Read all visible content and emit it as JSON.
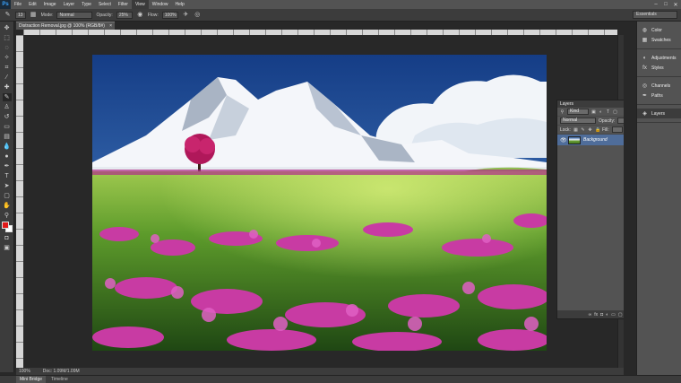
{
  "app": {
    "logo": "Ps",
    "menus": [
      "File",
      "Edit",
      "Image",
      "Layer",
      "Type",
      "Select",
      "Filter",
      "View",
      "Window",
      "Help"
    ],
    "active_menu": "View",
    "window_controls": [
      "–",
      "□",
      "✕"
    ]
  },
  "options_bar": {
    "mode_label": "Mode:",
    "mode_value": "Normal",
    "opacity_label": "Opacity:",
    "opacity_value": "25%",
    "flow_label": "Flow:",
    "flow_value": "100%",
    "brush_size": "13",
    "workspace": "Essentials"
  },
  "document": {
    "tab_title": "Distraction Removal.jpg @ 100% (RGB/8#)",
    "close": "×",
    "zoom": "100%",
    "doc_info": "Doc: 1.09M/1.09M"
  },
  "bottom_tabs": [
    "Mini Bridge",
    "Timeline"
  ],
  "layers_panel": {
    "title": "Layers",
    "filter_value": "Kind",
    "blend_mode": "Normal",
    "opacity_label": "Opacity:",
    "lock_label": "Lock:",
    "fill_label": "Fill:",
    "layer_name": "Background"
  },
  "dock": {
    "groups": [
      [
        "Color",
        "Swatches"
      ],
      [
        "Adjustments",
        "Styles"
      ],
      [
        "Channels",
        "Paths"
      ],
      [
        "Layers"
      ]
    ],
    "active": "Layers"
  },
  "colors": {
    "foreground": "#e01818",
    "background": "#ffffff",
    "accent": "#4f6d9a"
  }
}
